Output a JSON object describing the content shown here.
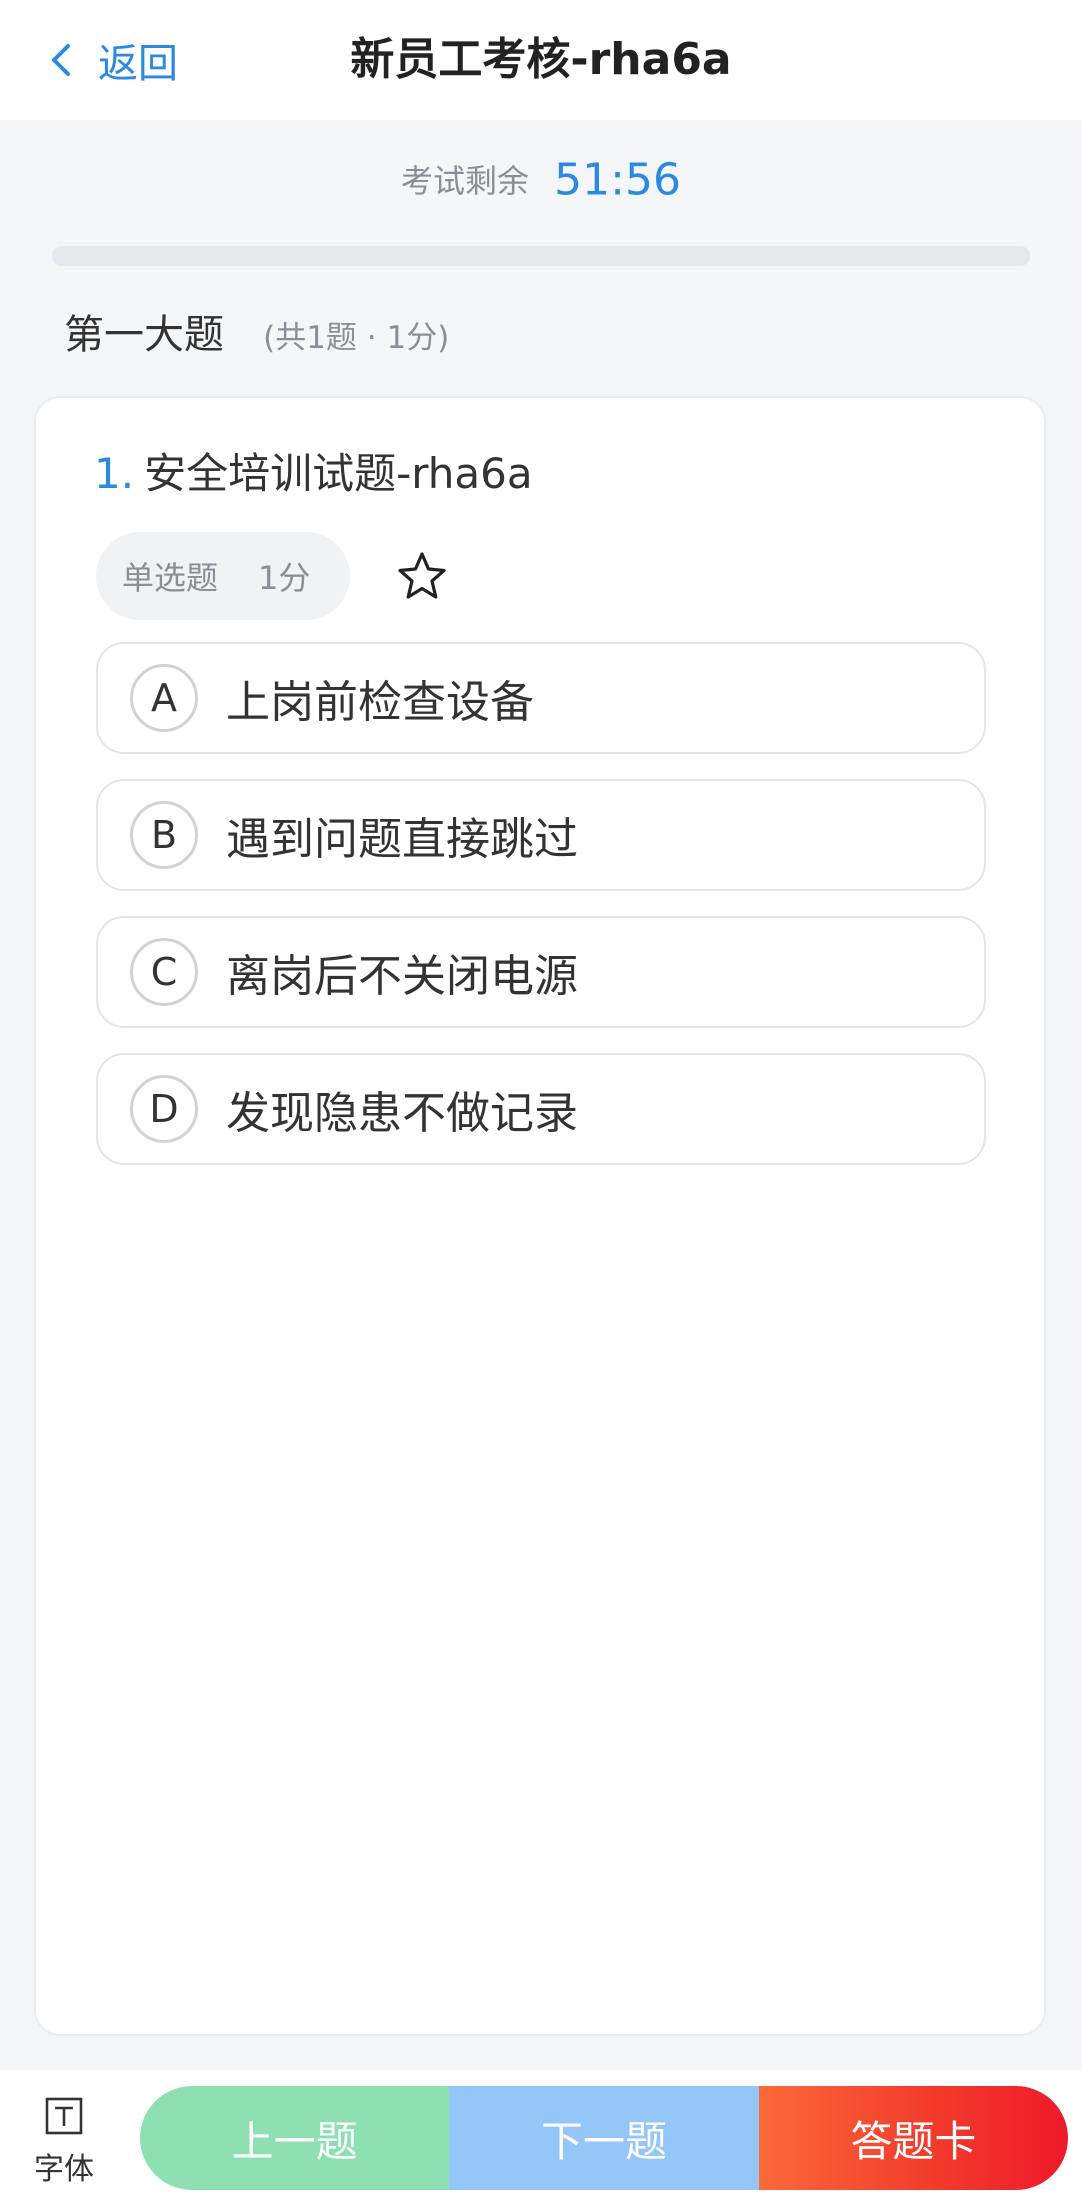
{
  "header": {
    "back_label": "返回",
    "title": "新员工考核-rha6a"
  },
  "timer": {
    "label": "考试剩余",
    "value": "51:56"
  },
  "progress": {
    "fraction": 0
  },
  "section": {
    "name": "第一大题",
    "meta": "(共1题 · 1分)"
  },
  "question": {
    "number": "1.",
    "text": "安全培训试题-rha6a",
    "type": "单选题",
    "score": "1分",
    "options": [
      {
        "letter": "A",
        "text": "上岗前检查设备"
      },
      {
        "letter": "B",
        "text": "遇到问题直接跳过"
      },
      {
        "letter": "C",
        "text": "离岗后不关闭电源"
      },
      {
        "letter": "D",
        "text": "发现隐患不做记录"
      }
    ]
  },
  "bottom": {
    "font_label": "字体",
    "prev_label": "上一题",
    "next_label": "下一题",
    "card_label": "答题卡"
  },
  "colors": {
    "accent": "#2b8ae0",
    "prev": "#8ee0b3",
    "next": "#94c6f8",
    "card": "#f2382b"
  },
  "icons": {
    "back": "chevron-left-icon",
    "favorite": "star-outline-icon",
    "font": "text-font-icon"
  }
}
